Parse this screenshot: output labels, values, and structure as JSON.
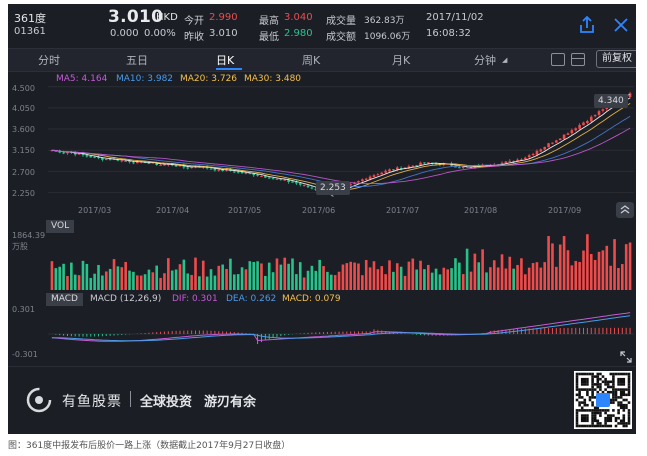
{
  "header": {
    "stock_name": "361度",
    "stock_code": "01361",
    "price": "3.010",
    "currency": "HKD",
    "change": "0.000",
    "change_pct": "0.00%",
    "open_label": "今开",
    "open_value": "2.990",
    "prev_close_label": "昨收",
    "prev_close_value": "3.010",
    "high_label": "最高",
    "high_value": "3.040",
    "low_label": "最低",
    "low_value": "2.980",
    "volume_label": "成交量",
    "volume_value": "362.83万",
    "turnover_label": "成交额",
    "turnover_value": "1096.06万",
    "date": "2017/11/02",
    "time": "16:08:32"
  },
  "tabs": [
    {
      "label": "分时"
    },
    {
      "label": "五日"
    },
    {
      "label": "日K"
    },
    {
      "label": "周K"
    },
    {
      "label": "月K"
    },
    {
      "label": "分钟"
    }
  ],
  "active_tab": "日K",
  "adjust_button": "前复权",
  "ma_legend": {
    "ma5": "MA5: 4.164",
    "ma10": "MA10: 3.982",
    "ma20": "MA20: 3.726",
    "ma30": "MA30: 3.480"
  },
  "price_axis": [
    "4.500",
    "4.050",
    "3.600",
    "3.150",
    "2.700",
    "2.250"
  ],
  "date_axis": [
    "2017/03",
    "2017/04",
    "2017/05",
    "2017/06",
    "2017/07",
    "2017/08",
    "2017/09"
  ],
  "low_badge": "2.253",
  "high_badge": "4.340",
  "vol_label": "VOL",
  "vol_axis_value": "1864.39",
  "vol_axis_unit": "万股",
  "macd_label": "MACD",
  "macd_legend": {
    "params": "MACD (12,26,9)",
    "dif": "DIF: 0.301",
    "dea": "DEA: 0.262",
    "macd": "MACD: 0.079"
  },
  "macd_axis": [
    "0.301",
    "-0.301"
  ],
  "footer": {
    "brand": "有鱼股票",
    "slogan1": "全球投资",
    "slogan2": "游刃有余"
  },
  "caption": "图：361度中报发布后股价一路上涨（数据截止2017年9月27日收盘）",
  "colors": {
    "up": "#ef4b4b",
    "down": "#27c38b",
    "ma5": "#ffffff",
    "ma10": "#f3c04d",
    "ma20": "#4a7bd8",
    "ma30": "#c55bd6",
    "background": "#1b1e25"
  },
  "chart_data": {
    "type": "candlestick",
    "y_axis_ticks": [
      4.5,
      4.05,
      3.6,
      3.15,
      2.7,
      2.25
    ],
    "ylim": [
      2.05,
      4.6
    ],
    "x_ticks": [
      "2017/03",
      "2017/04",
      "2017/05",
      "2017/06",
      "2017/07",
      "2017/08",
      "2017/09"
    ],
    "low_marker": 2.253,
    "high_marker": 4.34,
    "close_trend": [
      3.15,
      3.13,
      3.1,
      3.12,
      3.08,
      3.05,
      3.02,
      3.0,
      2.98,
      2.96,
      2.97,
      2.95,
      2.93,
      2.92,
      2.9,
      2.88,
      2.9,
      2.87,
      2.85,
      2.84,
      2.86,
      2.83,
      2.8,
      2.78,
      2.8,
      2.82,
      2.79,
      2.76,
      2.74,
      2.72,
      2.73,
      2.7,
      2.68,
      2.66,
      2.65,
      2.63,
      2.6,
      2.58,
      2.55,
      2.52,
      2.5,
      2.47,
      2.44,
      2.4,
      2.36,
      2.33,
      2.3,
      2.27,
      2.26,
      2.3,
      2.35,
      2.4,
      2.46,
      2.52,
      2.58,
      2.62,
      2.66,
      2.7,
      2.74,
      2.76,
      2.78,
      2.8,
      2.83,
      2.86,
      2.88,
      2.87,
      2.85,
      2.86,
      2.84,
      2.82,
      2.8,
      2.78,
      2.79,
      2.81,
      2.83,
      2.85,
      2.87,
      2.88,
      2.9,
      2.92,
      2.96,
      3.0,
      3.06,
      3.14,
      3.2,
      3.28,
      3.35,
      3.42,
      3.5,
      3.58,
      3.66,
      3.74,
      3.82,
      3.9,
      4.0,
      4.08,
      4.15,
      4.22,
      4.3,
      4.34
    ],
    "macd_range": [
      -0.301,
      0.301
    ]
  }
}
